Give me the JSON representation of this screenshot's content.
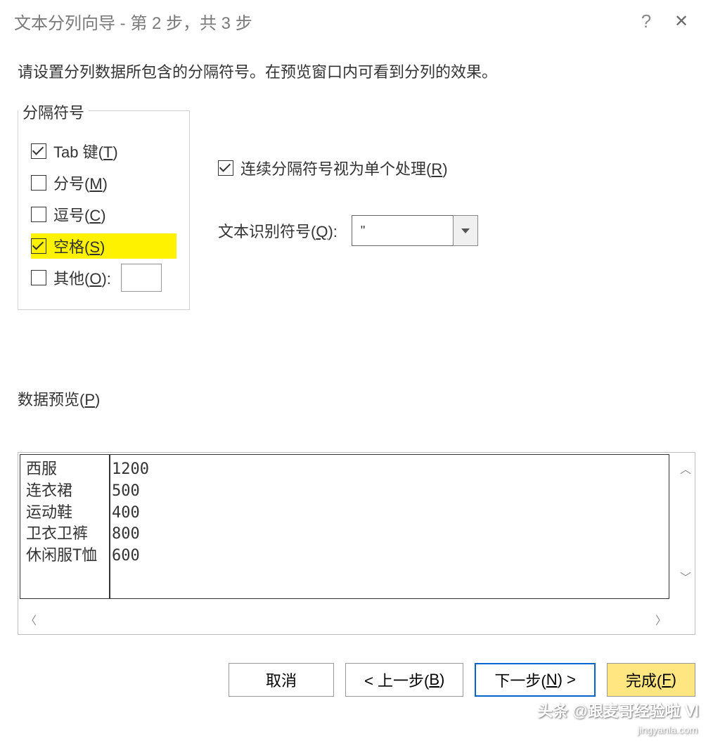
{
  "titlebar": {
    "title": "文本分列向导 - 第 2 步，共 3 步",
    "help": "?",
    "close": "✕"
  },
  "instruction": "请设置分列数据所包含的分隔符号。在预览窗口内可看到分列的效果。",
  "delimiterGroup": {
    "label": "分隔符号",
    "tab": "Tab 键(T)",
    "semicolon": "分号(M)",
    "comma": "逗号(C)",
    "space": "空格(S)",
    "other": "其他(O):"
  },
  "options": {
    "consecutive": "连续分隔符号视为单个处理(R)",
    "textQualifierLabel": "文本识别符号(Q):",
    "textQualifierValue": "\""
  },
  "preview": {
    "label": "数据预览(P)",
    "rows": [
      {
        "col1": "西服",
        "col2": "1200"
      },
      {
        "col1": "连衣裙",
        "col2": "500"
      },
      {
        "col1": "运动鞋",
        "col2": "400"
      },
      {
        "col1": "卫衣卫裤",
        "col2": "800"
      },
      {
        "col1": "休闲服T恤",
        "col2": "600"
      }
    ]
  },
  "buttons": {
    "cancel": "取消",
    "back": "< 上一步(B)",
    "next": "下一步(N) >",
    "finish": "完成(F)"
  },
  "watermark": {
    "line1": "头条 @跟麦哥经验啦 Ⅵ",
    "line2": "jingyanla.com"
  }
}
